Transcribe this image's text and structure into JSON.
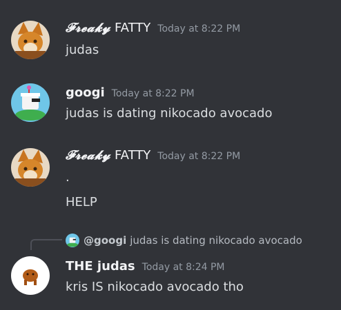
{
  "messages": [
    {
      "username_stylized": "𝓕𝓻𝓮𝓪𝓴𝔂",
      "username_plain": "FATTY",
      "timestamp": "Today at 8:22 PM",
      "lines": [
        "judas"
      ],
      "avatar": "fox-character-avatar"
    },
    {
      "username": "googi",
      "timestamp": "Today at 8:22 PM",
      "lines": [
        "judas is dating nikocado avocado"
      ],
      "avatar": "chef-character-avatar"
    },
    {
      "username_stylized": "𝓕𝓻𝓮𝓪𝓴𝔂",
      "username_plain": "FATTY",
      "timestamp": "Today at 8:22 PM",
      "lines": [
        ".",
        "HELP"
      ],
      "avatar": "fox-character-avatar"
    },
    {
      "reply": {
        "mention": "@googi",
        "text": "judas is dating nikocado avocado"
      },
      "username": "THE judas",
      "timestamp": "Today at 8:24 PM",
      "lines": [
        "kris IS nikocado avocado tho"
      ],
      "avatar": "brown-creature-avatar"
    }
  ],
  "colors": {
    "background": "#313338",
    "text": "#dbdee1",
    "timestamp": "#949ba4",
    "username": "#f2f3f5"
  }
}
